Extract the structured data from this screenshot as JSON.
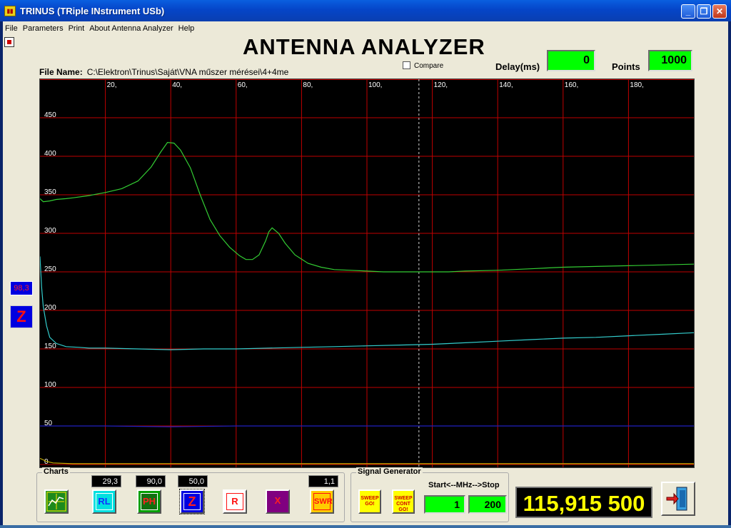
{
  "window": {
    "title": "TRINUS (TRiple INstrument USb)",
    "icon": "app-icon"
  },
  "menu": [
    "File",
    "Parameters",
    "Print",
    "About Antenna Analyzer",
    "Help"
  ],
  "header": {
    "title": "ANTENNA ANALYZER",
    "file_label": "File Name:",
    "file_value": "C:\\Elektron\\Trinus\\Saját\\VNA műszer mérései\\4+4me",
    "compare_label": "Compare",
    "delay_label": "Delay(ms)",
    "delay_value": "0",
    "points_label": "Points",
    "points_value": "1000"
  },
  "side": {
    "value": "98,3",
    "mode_icon": "Z"
  },
  "chart_data": {
    "type": "line",
    "x_ticks": [
      "20,",
      "40,",
      "60,",
      "80,",
      "100,",
      "120,",
      "140,",
      "160,",
      "180,"
    ],
    "y_ticks": [
      "0",
      "50",
      "100",
      "150",
      "200",
      "250",
      "300",
      "350",
      "400",
      "450"
    ],
    "xlim": [
      0,
      200
    ],
    "ylim": [
      0,
      500
    ],
    "cursor_x": 115.9,
    "grid": true,
    "colors": {
      "grid": "#c00000",
      "cursor": "#d0d0d0",
      "labels": "#ffffff"
    },
    "series": [
      {
        "color": "#33cc33",
        "x": [
          0,
          1,
          3,
          5,
          8,
          10,
          15,
          20,
          25,
          30,
          34,
          37,
          39,
          41,
          43,
          46,
          49,
          52,
          55,
          58,
          61,
          63,
          65,
          67,
          69,
          70,
          71,
          73,
          75,
          78,
          82,
          86,
          90,
          95,
          100,
          105,
          110,
          115,
          120,
          125,
          130,
          140,
          150,
          160,
          170,
          180,
          190,
          200
        ],
        "y": [
          345,
          341,
          342,
          344,
          345,
          346,
          349,
          353,
          358,
          368,
          386,
          406,
          418,
          417,
          408,
          385,
          350,
          318,
          297,
          282,
          271,
          266,
          266,
          272,
          290,
          302,
          307,
          300,
          287,
          272,
          261,
          256,
          253,
          252,
          251,
          250,
          250,
          250,
          250,
          250,
          251,
          252,
          254,
          256,
          257,
          258,
          259,
          260
        ]
      },
      {
        "color": "#33cccc",
        "x": [
          0,
          0.5,
          1,
          2,
          3,
          5,
          8,
          12,
          15,
          20,
          30,
          40,
          50,
          60,
          70,
          80,
          90,
          100,
          110,
          120,
          130,
          140,
          150,
          160,
          170,
          180,
          190,
          200
        ],
        "y": [
          270,
          230,
          205,
          180,
          165,
          157,
          153,
          152,
          151,
          151,
          150,
          149,
          150,
          150,
          151,
          152,
          153,
          154,
          155,
          156,
          158,
          160,
          162,
          164,
          165,
          167,
          169,
          171
        ]
      },
      {
        "color": "#2020c0",
        "x": [
          0,
          20,
          40,
          60,
          80,
          100,
          120,
          140,
          160,
          180,
          200
        ],
        "y": [
          50,
          50,
          49,
          50,
          50,
          50,
          50,
          50,
          50,
          50,
          50
        ]
      },
      {
        "color": "#c8b000",
        "x": [
          0,
          1,
          2,
          4,
          10,
          30,
          60,
          100,
          140,
          200
        ],
        "y": [
          8,
          6,
          4,
          2,
          1,
          1,
          1,
          1,
          1,
          1
        ]
      }
    ]
  },
  "charts_group": {
    "legend": "Charts",
    "readouts": {
      "rl": "29,3",
      "ph": "90,0",
      "z": "50,0",
      "swr": "1,1"
    },
    "buttons": {
      "rl": "RL",
      "ph": "PH",
      "z": "Z",
      "r": "R",
      "x": "X",
      "swr": "SWR"
    }
  },
  "signal_group": {
    "legend": "Signal Generator",
    "sweep_go": "SWEEP GO!",
    "sweep_cont_go": "SWEEP CONT GO!",
    "range_label": "Start<--MHz-->Stop",
    "start_value": "1",
    "stop_value": "200"
  },
  "frequency_display": "115,915 500"
}
